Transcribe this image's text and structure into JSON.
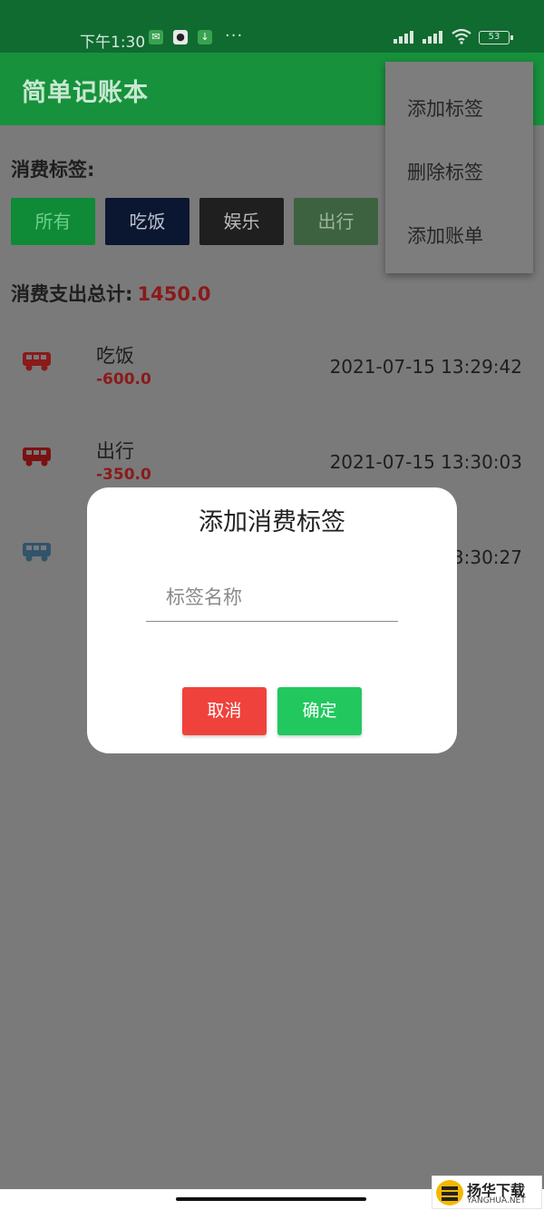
{
  "status_bar": {
    "time": "下午1:30",
    "icons": [
      "wechat-icon",
      "qq-icon",
      "download-icon"
    ],
    "more": "···",
    "battery": "53"
  },
  "app_bar": {
    "title": "简单记账本"
  },
  "tags_section": {
    "label": "消费标签:",
    "tags": [
      {
        "label": "所有",
        "bg": "#0f8a36",
        "color": "#6ecf8e"
      },
      {
        "label": "吃饭",
        "bg": "#0b1630",
        "color": "#b9c0cf"
      },
      {
        "label": "娱乐",
        "bg": "#1f1f1f",
        "color": "#b9b9b9"
      },
      {
        "label": "出行",
        "bg": "#3d6240",
        "color": "#9bb59c"
      }
    ]
  },
  "total": {
    "label": "消费支出总计:",
    "value": "1450.0"
  },
  "bills": [
    {
      "category": "吃饭",
      "amount": "-600.0",
      "time": "2021-07-15 13:29:42",
      "icon_color": "#8b1a1a"
    },
    {
      "category": "出行",
      "amount": "-350.0",
      "time": "2021-07-15 13:30:03",
      "icon_color": "#7a1212"
    },
    {
      "category": "",
      "amount": "",
      "time": "3:30:27",
      "icon_color": "#31546b"
    }
  ],
  "menu": {
    "items": [
      "添加标签",
      "删除标签",
      "添加账单"
    ]
  },
  "dialog": {
    "title": "添加消费标签",
    "input_placeholder": "标签名称",
    "cancel_label": "取消",
    "confirm_label": "确定"
  },
  "watermark": {
    "text": "扬华下载",
    "sub": "YANGHUA.NET"
  }
}
